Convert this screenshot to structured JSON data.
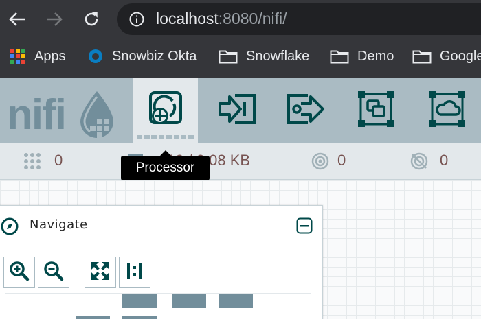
{
  "browser": {
    "url_host": "localhost",
    "url_rest": ":8080/nifi/",
    "bookmarks": [
      {
        "label": "Apps",
        "icon": "apps-grid-icon"
      },
      {
        "label": "Snowbiz Okta",
        "icon": "okta-icon"
      },
      {
        "label": "Snowflake",
        "icon": "folder-icon"
      },
      {
        "label": "Demo",
        "icon": "folder-icon"
      },
      {
        "label": "Google",
        "icon": "folder-icon"
      }
    ]
  },
  "nifi": {
    "logo_text": "nifi",
    "toolbar": [
      {
        "name": "processor",
        "icon": "processor-icon",
        "active": true
      },
      {
        "name": "input-port",
        "icon": "input-port-icon"
      },
      {
        "name": "output-port",
        "icon": "output-port-icon"
      },
      {
        "name": "process-group",
        "icon": "process-group-icon"
      },
      {
        "name": "remote-process-group",
        "icon": "remote-process-group-icon"
      }
    ],
    "tooltip": "Processor",
    "status": {
      "active_threads": "0",
      "queued": "19 / 9.08 KB",
      "transmitting": "0",
      "not_transmitting": "0"
    }
  },
  "navigate": {
    "title": "Navigate",
    "buttons": [
      "zoom-in-icon",
      "zoom-out-icon",
      "fit-icon",
      "actual-size-icon"
    ]
  },
  "colors": {
    "header_bg": "#aabbc3",
    "icon_dark": "#004849",
    "status_value": "#775351",
    "chrome_bg": "#35363a"
  }
}
